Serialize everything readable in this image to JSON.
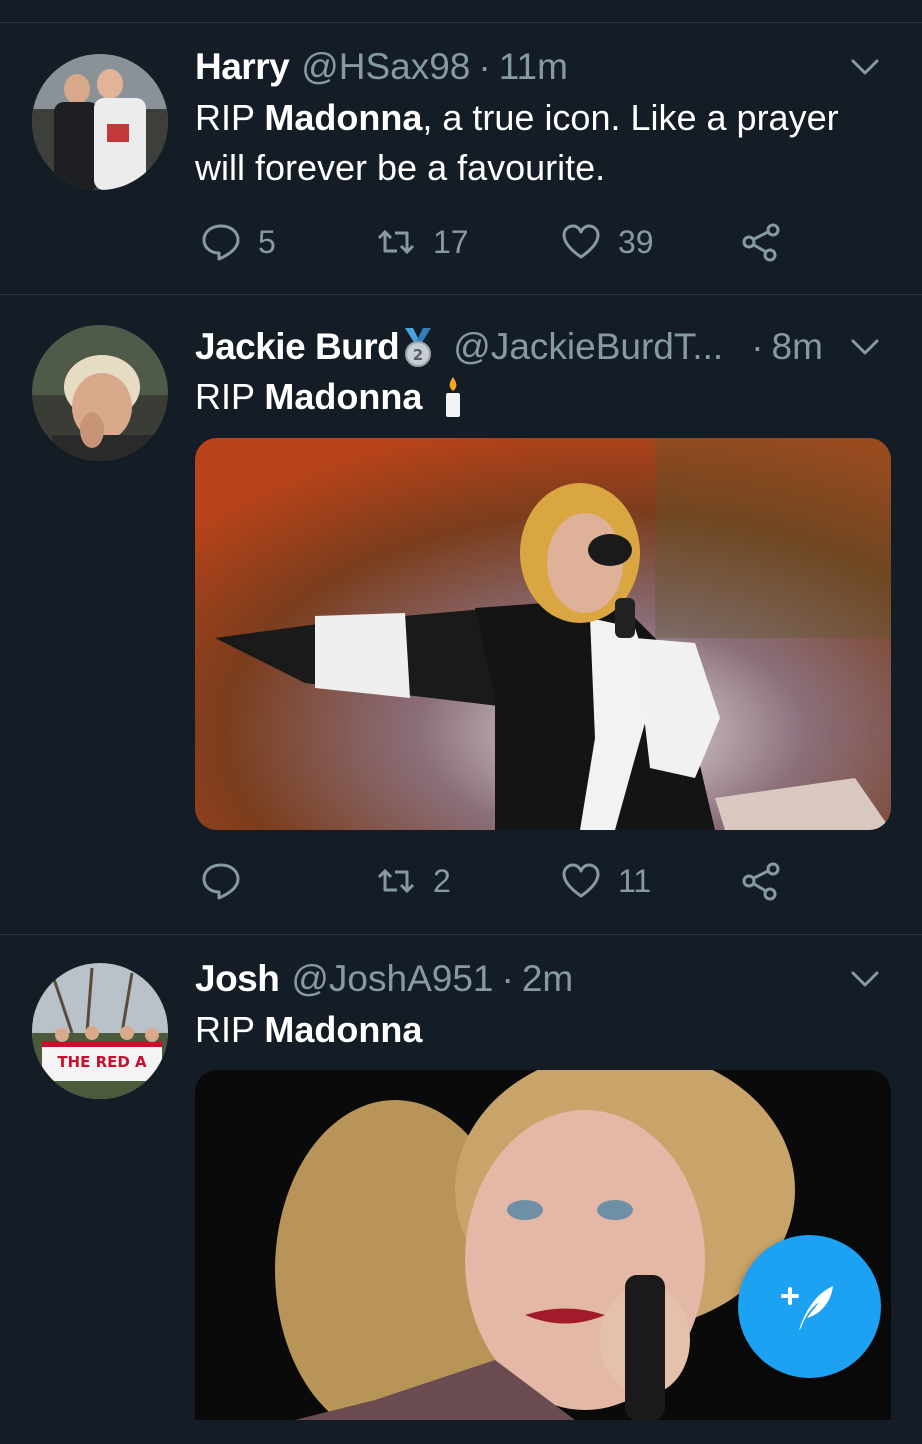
{
  "colors": {
    "background": "#141d26",
    "muted": "#8899a6",
    "accent": "#1da1f2",
    "divider": "#2a3540"
  },
  "tweets": [
    {
      "name": "Harry",
      "handle": "@HSax98",
      "sep": "·",
      "time": "11m",
      "text_prefix": "RIP ",
      "text_bold": "Madonna",
      "text_suffix": ", a true icon. Like a prayer will forever be a favourite.",
      "replies": "5",
      "retweets": "17",
      "likes": "39"
    },
    {
      "name": "Jackie Burd",
      "badge_icon": "medal-icon",
      "badge_number": "2",
      "handle": "@JackieBurdT...",
      "sep": "·",
      "time": "8m",
      "text_prefix": "RIP ",
      "text_bold": "Madonna",
      "emoji_icon": "candle-icon",
      "replies": "",
      "retweets": "2",
      "likes": "11"
    },
    {
      "name": "Josh",
      "handle": "@JoshA951",
      "sep": "·",
      "time": "2m",
      "text_prefix": "RIP ",
      "text_bold": "Madonna",
      "avatar_banner_text": "THE RED A"
    }
  ],
  "compose_icon": "compose-tweet-icon"
}
